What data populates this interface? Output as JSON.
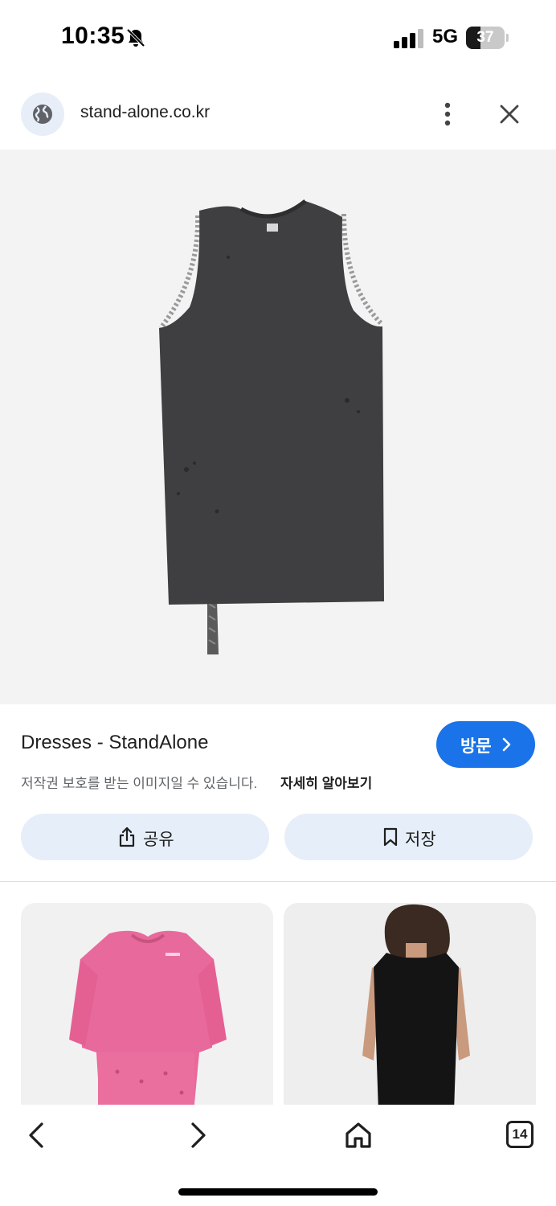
{
  "status_bar": {
    "time": "10:35",
    "network": "5G",
    "battery_percent": "37",
    "battery_level": 0.37,
    "icons": [
      "bell-slash-icon",
      "signal-icon",
      "battery-icon"
    ]
  },
  "url_bar": {
    "url": "stand-alone.co.kr",
    "icons": [
      "globe-icon",
      "more-vert-icon",
      "close-icon"
    ]
  },
  "result": {
    "title": "Dresses - StandAlone",
    "visit_label": "방문",
    "copyright_notice": "저작권 보호를 받는 이미지일 수 있습니다.",
    "learn_more": "자세히 알아보기",
    "share_label": "공유",
    "save_label": "저장"
  },
  "bottom_nav": {
    "tab_count": "14",
    "icons": [
      "back-icon",
      "forward-icon",
      "home-icon",
      "tabs-icon"
    ]
  },
  "colors": {
    "accent": "#1a73e8",
    "action_bg": "#e6eef9",
    "hero_bg": "#f3f3f3"
  }
}
